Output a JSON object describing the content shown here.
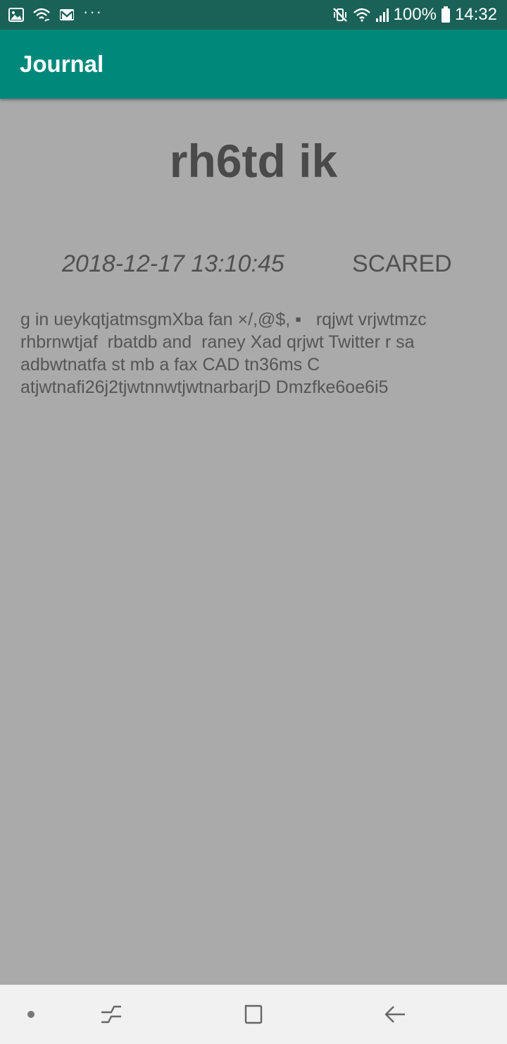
{
  "status_bar": {
    "icons_left": [
      "image-icon",
      "wifi-calling-icon",
      "gmail-icon",
      "more-notifications-icon"
    ],
    "icons_right": [
      "vibrate-mute-icon",
      "wifi-icon",
      "signal-icon",
      "battery-icon"
    ],
    "more_dots": "···",
    "battery": "100%",
    "time": "14:32"
  },
  "app_bar": {
    "title": "Journal",
    "color": "#00897b"
  },
  "entry": {
    "title": "rh6td ik",
    "date": "2018-12-17 13:10:45",
    "mood": "SCARED",
    "body": "g in ueykqtjatmsgmXba fan ×/,@$, ▪   rqjwt vrjwtmzc rhbrnwtjaf  rbatdb and  raney Xad qrjwt Twitter r sa adbwtnatfa st mb a fax CAD tn36ms C atjwtnafi26j2tjwtnnwtjwtnarbarjD Dmzfke6oe6i5"
  },
  "nav_bar": {
    "icons": [
      "dot-icon",
      "recent-apps-icon",
      "home-icon",
      "back-icon"
    ]
  },
  "colors": {
    "status_bar": "#1a6158",
    "background": "#aaaaaa",
    "nav_bar": "#f1f1f1"
  }
}
